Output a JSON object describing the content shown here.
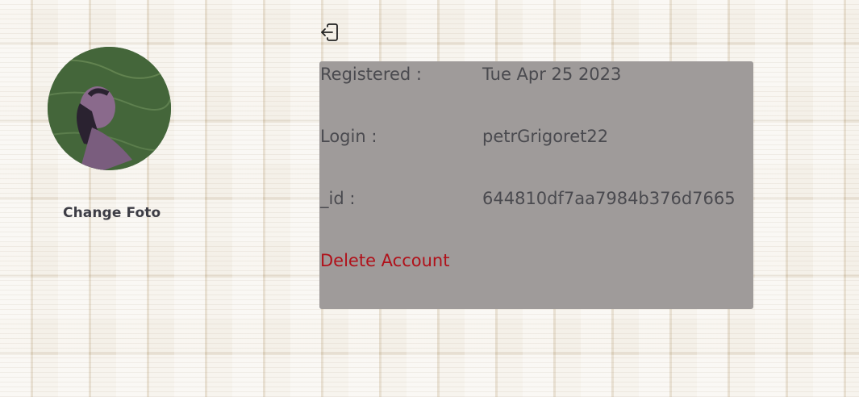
{
  "profile": {
    "change_photo_label": "Change Foto"
  },
  "header": {
    "logout_icon": "logout-icon"
  },
  "info": {
    "rows": [
      {
        "label": "Registered :",
        "value": "Tue Apr 25 2023"
      },
      {
        "label": "Login :",
        "value": "petrGrigoret22"
      },
      {
        "label": "_id :",
        "value": "644810df7aa7984b376d7665"
      }
    ],
    "delete_label": "Delete Account"
  },
  "colors": {
    "card_background": "#9f9b9a",
    "text": "#4a4a4f",
    "danger": "#b0111a"
  }
}
